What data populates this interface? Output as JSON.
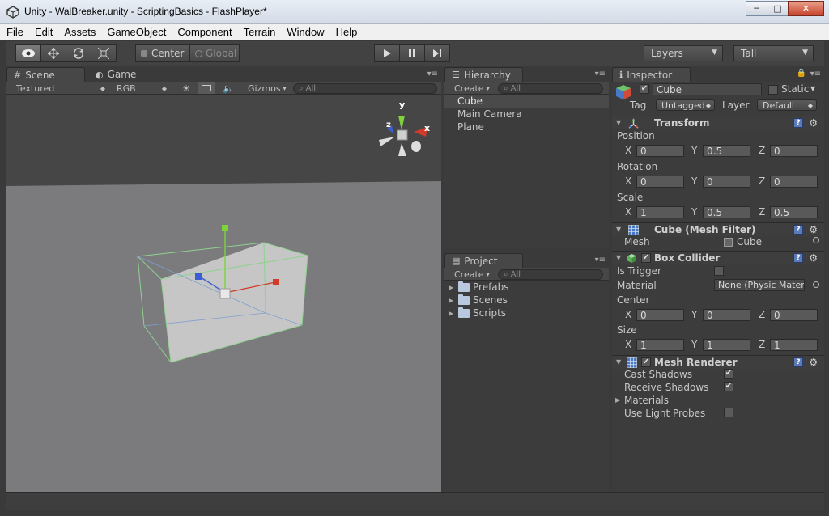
{
  "window": {
    "title": "Unity - WalBreaker.unity - ScriptingBasics - FlashPlayer*",
    "minimize": "─",
    "maximize": "□",
    "close": "✕"
  },
  "menu": [
    "File",
    "Edit",
    "Assets",
    "GameObject",
    "Component",
    "Terrain",
    "Window",
    "Help"
  ],
  "toolbar": {
    "pivot_mode": "Center",
    "pivot_rotation": "Global",
    "layers": "Layers",
    "layout": "Tall"
  },
  "scene_panel": {
    "tab_scene": "Scene",
    "tab_game": "Game",
    "render_mode": "Textured",
    "color_mode": "RGB",
    "gizmos": "Gizmos",
    "search_placeholder": "All",
    "axis_x": "x",
    "axis_y": "y",
    "axis_z": "z"
  },
  "hierarchy": {
    "tab": "Hierarchy",
    "create": "Create",
    "search_placeholder": "All",
    "items": [
      "Cube",
      "Main Camera",
      "Plane"
    ]
  },
  "project": {
    "tab": "Project",
    "create": "Create",
    "search_placeholder": "All",
    "folders": [
      "Prefabs",
      "Scenes",
      "Scripts"
    ]
  },
  "inspector": {
    "tab": "Inspector",
    "object_name": "Cube",
    "static_label": "Static",
    "tag_label": "Tag",
    "tag_value": "Untagged",
    "layer_label": "Layer",
    "layer_value": "Default",
    "transform": {
      "title": "Transform",
      "position_label": "Position",
      "rotation_label": "Rotation",
      "scale_label": "Scale",
      "position": {
        "x": "0",
        "y": "0.5",
        "z": "0"
      },
      "rotation": {
        "x": "0",
        "y": "0",
        "z": "0"
      },
      "scale": {
        "x": "1",
        "y": "0.5",
        "z": "0.5"
      }
    },
    "mesh_filter": {
      "title": "Cube (Mesh Filter)",
      "mesh_label": "Mesh",
      "mesh_value": "Cube"
    },
    "box_collider": {
      "title": "Box Collider",
      "is_trigger_label": "Is Trigger",
      "material_label": "Material",
      "material_value": "None (Physic Mater",
      "center_label": "Center",
      "size_label": "Size",
      "center": {
        "x": "0",
        "y": "0",
        "z": "0"
      },
      "size": {
        "x": "1",
        "y": "1",
        "z": "1"
      }
    },
    "mesh_renderer": {
      "title": "Mesh Renderer",
      "cast_shadows_label": "Cast Shadows",
      "receive_shadows_label": "Receive Shadows",
      "materials_label": "Materials",
      "light_probes_label": "Use Light Probes"
    },
    "axis_labels": {
      "x": "X",
      "y": "Y",
      "z": "Z"
    }
  },
  "icons": [
    "unity-logo-icon",
    "hand-tool-icon",
    "move-tool-icon",
    "rotate-tool-icon",
    "scale-tool-icon",
    "play-icon",
    "pause-icon",
    "step-icon",
    "lock-icon",
    "help-icon",
    "gear-icon",
    "folder-icon"
  ]
}
